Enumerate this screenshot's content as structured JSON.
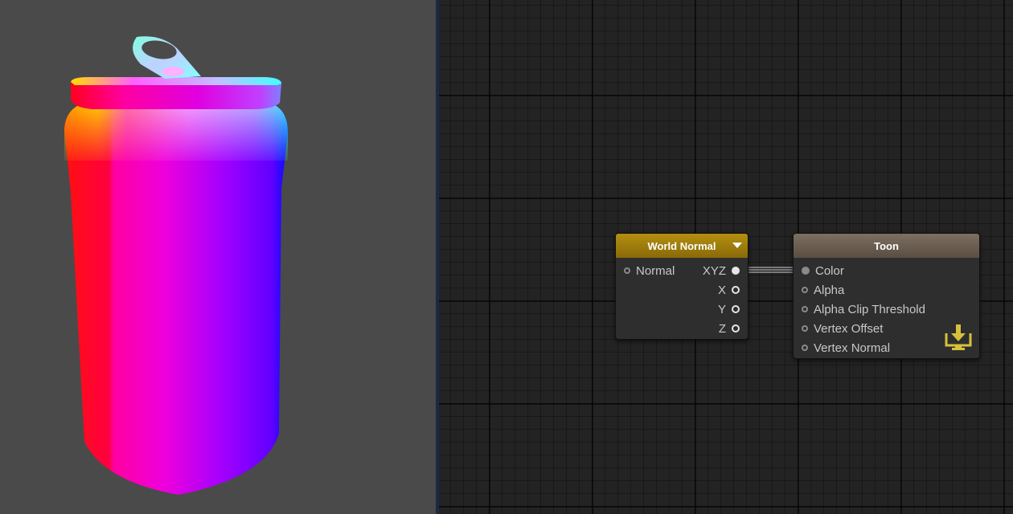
{
  "world_normal_node": {
    "title": "World Normal",
    "input_label": "Normal",
    "outputs": [
      "XYZ",
      "X",
      "Y",
      "Z"
    ]
  },
  "toon_node": {
    "title": "Toon",
    "inputs": [
      "Color",
      "Alpha",
      "Alpha Clip Threshold",
      "Vertex Offset",
      "Vertex Normal"
    ]
  },
  "colors": {
    "viewport_bg": "#4a4a4a",
    "graph_bg": "#232323",
    "world_normal_header": "#b38f10",
    "toon_header": "#7d6f60",
    "master_icon": "#d6c13a"
  },
  "icons": [
    "dropdown-arrow-icon",
    "master-output-icon"
  ]
}
